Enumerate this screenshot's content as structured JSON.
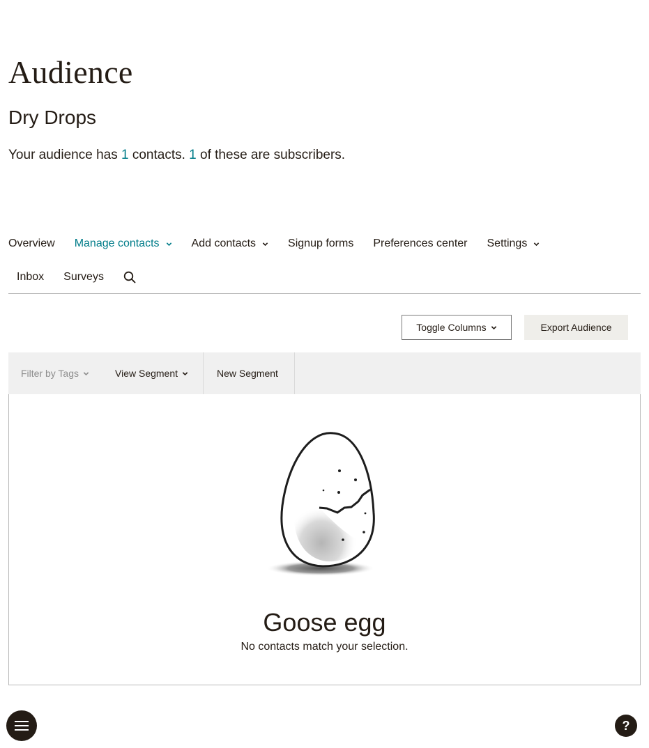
{
  "header": {
    "title": "Audience",
    "audience_name": "Dry Drops",
    "summary": {
      "prefix": "Your audience has ",
      "contacts_count": "1",
      "middle": " contacts. ",
      "subscribers_count": "1",
      "suffix": " of these are subscribers."
    }
  },
  "nav": {
    "items": [
      {
        "label": "Overview",
        "has_dropdown": false,
        "active": false
      },
      {
        "label": "Manage contacts",
        "has_dropdown": true,
        "active": true
      },
      {
        "label": "Add contacts",
        "has_dropdown": true,
        "active": false
      },
      {
        "label": "Signup forms",
        "has_dropdown": false,
        "active": false
      },
      {
        "label": "Preferences center",
        "has_dropdown": false,
        "active": false
      },
      {
        "label": "Settings",
        "has_dropdown": true,
        "active": false
      },
      {
        "label": "Inbox",
        "has_dropdown": false,
        "active": false
      },
      {
        "label": "Surveys",
        "has_dropdown": false,
        "active": false
      }
    ],
    "search_icon": "search-icon"
  },
  "toolbar": {
    "toggle_columns": "Toggle Columns",
    "export_audience": "Export Audience"
  },
  "filterbar": {
    "filter_by_tags": "Filter by Tags",
    "view_segment": "View Segment",
    "new_segment": "New Segment"
  },
  "empty_state": {
    "title": "Goose egg",
    "message": "No contacts match your selection.",
    "illustration": "cracked-egg"
  },
  "fabs": {
    "menu_icon": "hamburger-menu-icon",
    "help_label": "?"
  },
  "colors": {
    "accent": "#007c89",
    "text": "#241c15",
    "filterbar_bg": "#f0f0f0",
    "export_bg": "#efeeea"
  }
}
